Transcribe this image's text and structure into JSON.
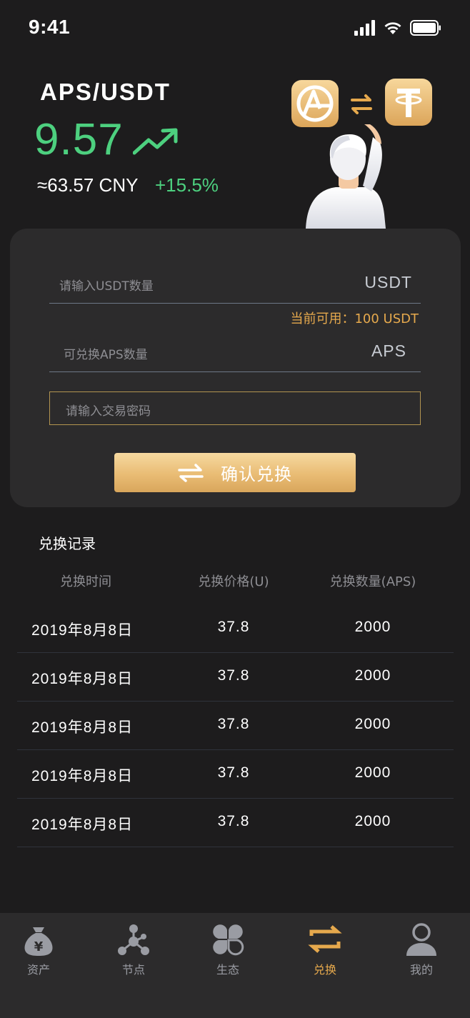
{
  "status_bar": {
    "time": "9:41"
  },
  "header": {
    "pair": "APS/USDT",
    "price": "9.57",
    "cny": "≈63.57 CNY",
    "change": "+15.5%",
    "colors": {
      "up": "#4dd07f",
      "accent": "#e6a94d"
    }
  },
  "exchange_form": {
    "usdt_placeholder": "请输入USDT数量",
    "usdt_unit": "USDT",
    "available": "当前可用：100 USDT",
    "aps_placeholder": "可兑换APS数量",
    "aps_unit": "APS",
    "password_placeholder": "请输入交易密码",
    "confirm_label": "确认兑换"
  },
  "records": {
    "title": "兑换记录",
    "columns": [
      "兑换时间",
      "兑换价格(U)",
      "兑换数量(APS)"
    ],
    "rows": [
      [
        "2019年8月8日",
        "37.8",
        "2000"
      ],
      [
        "2019年8月8日",
        "37.8",
        "2000"
      ],
      [
        "2019年8月8日",
        "37.8",
        "2000"
      ],
      [
        "2019年8月8日",
        "37.8",
        "2000"
      ],
      [
        "2019年8月8日",
        "37.8",
        "2000"
      ]
    ]
  },
  "tabbar": {
    "items": [
      {
        "label": "资产",
        "icon": "money-bag-icon"
      },
      {
        "label": "节点",
        "icon": "nodes-icon"
      },
      {
        "label": "生态",
        "icon": "ecosystem-icon"
      },
      {
        "label": "兑换",
        "icon": "exchange-icon",
        "active": true
      },
      {
        "label": "我的",
        "icon": "profile-icon"
      }
    ]
  }
}
